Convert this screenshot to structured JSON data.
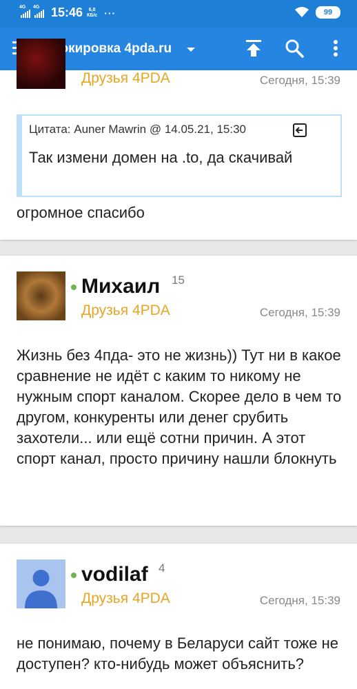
{
  "status_bar": {
    "network1": "4G",
    "network2": "4G",
    "time": "15:46",
    "speed_value": "6,8",
    "speed_unit": "КБ/с",
    "more": "···",
    "battery": "99"
  },
  "toolbar": {
    "title": "Блокировка 4pda.ru",
    "icons": [
      "menu-icon",
      "dropdown-caret-icon",
      "scroll-top-icon",
      "search-icon",
      "more-vert-icon"
    ]
  },
  "posts": [
    {
      "group": "Друзья 4PDA",
      "date": "Сегодня, 15:39",
      "quote": {
        "header": "Цитата: Auner Mawrin @ 14.05.21, 15:30",
        "text": "Так измени домен на .to, да скачивай"
      },
      "text": "огромное спасибо"
    },
    {
      "username": "Михаил",
      "reputation": "15",
      "group": "Друзья 4PDA",
      "date": "Сегодня, 15:39",
      "text": "Жизнь без 4пда- это не жизнь)) Тут ни в какое сравнение не идёт с каким то никому не нужным спорт каналом. Скорее дело в чем то другом, конкуренты или денег срубить захотели... или ещё сотни причин. А этот спорт канал, просто причину нашли блокнуть"
    },
    {
      "username": "vodilaf",
      "reputation": "4",
      "group": "Друзья 4PDA",
      "date": "Сегодня, 15:39",
      "text": "не понимаю, почему в Беларуси сайт тоже не доступен? кто-нибудь может объяснить?"
    }
  ],
  "colors": {
    "status_bar": "#1e7fd6",
    "toolbar": "#2685e0",
    "group": "#e8a526",
    "online": "#6fb353",
    "quote_border": "#bde0f7"
  }
}
